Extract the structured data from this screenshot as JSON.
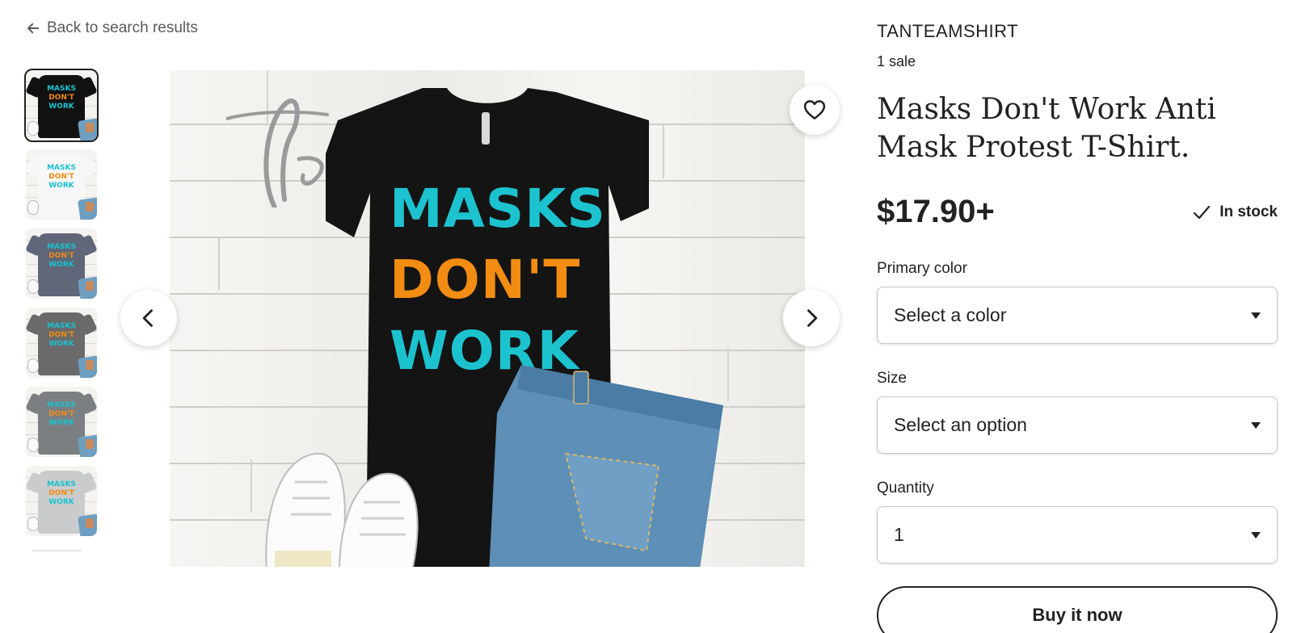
{
  "nav": {
    "back_label": "Back to search results"
  },
  "thumbnails": [
    {
      "shirt_color": "#111111",
      "lines": [
        "MASKS",
        "DON'T",
        "WORK"
      ]
    },
    {
      "shirt_color": "#f7f7f7",
      "lines": [
        "MASKS",
        "DON'T",
        "WORK"
      ]
    },
    {
      "shirt_color": "#5f6778",
      "lines": [
        "MASKS",
        "DON'T",
        "WORK"
      ]
    },
    {
      "shirt_color": "#6a6a6a",
      "lines": [
        "MASKS",
        "DON'T",
        "WORK"
      ]
    },
    {
      "shirt_color": "#7c7f82",
      "lines": [
        "MASKS",
        "DON'T",
        "WORK"
      ]
    },
    {
      "shirt_color": "#c9cbcd",
      "lines": [
        "MASKS",
        "DON'T",
        "WORK"
      ]
    }
  ],
  "main_image": {
    "shirt_color": "#141414",
    "lines": [
      "MASKS",
      "DON'T",
      "WORK"
    ]
  },
  "listing": {
    "shop_name": "TANTEAMSHIRT",
    "sales": "1 sale",
    "title": "Masks Don't Work Anti Mask Protest T-Shirt.",
    "price": "$17.90+",
    "stock": "In stock"
  },
  "options": {
    "color_label": "Primary color",
    "color_value": "Select a color",
    "size_label": "Size",
    "size_value": "Select an option",
    "quantity_label": "Quantity",
    "quantity_value": "1"
  },
  "actions": {
    "buy_label": "Buy it now"
  },
  "colors": {
    "text": "#222222",
    "accent_teal": "#1cc3cf",
    "accent_orange": "#f28c12"
  }
}
